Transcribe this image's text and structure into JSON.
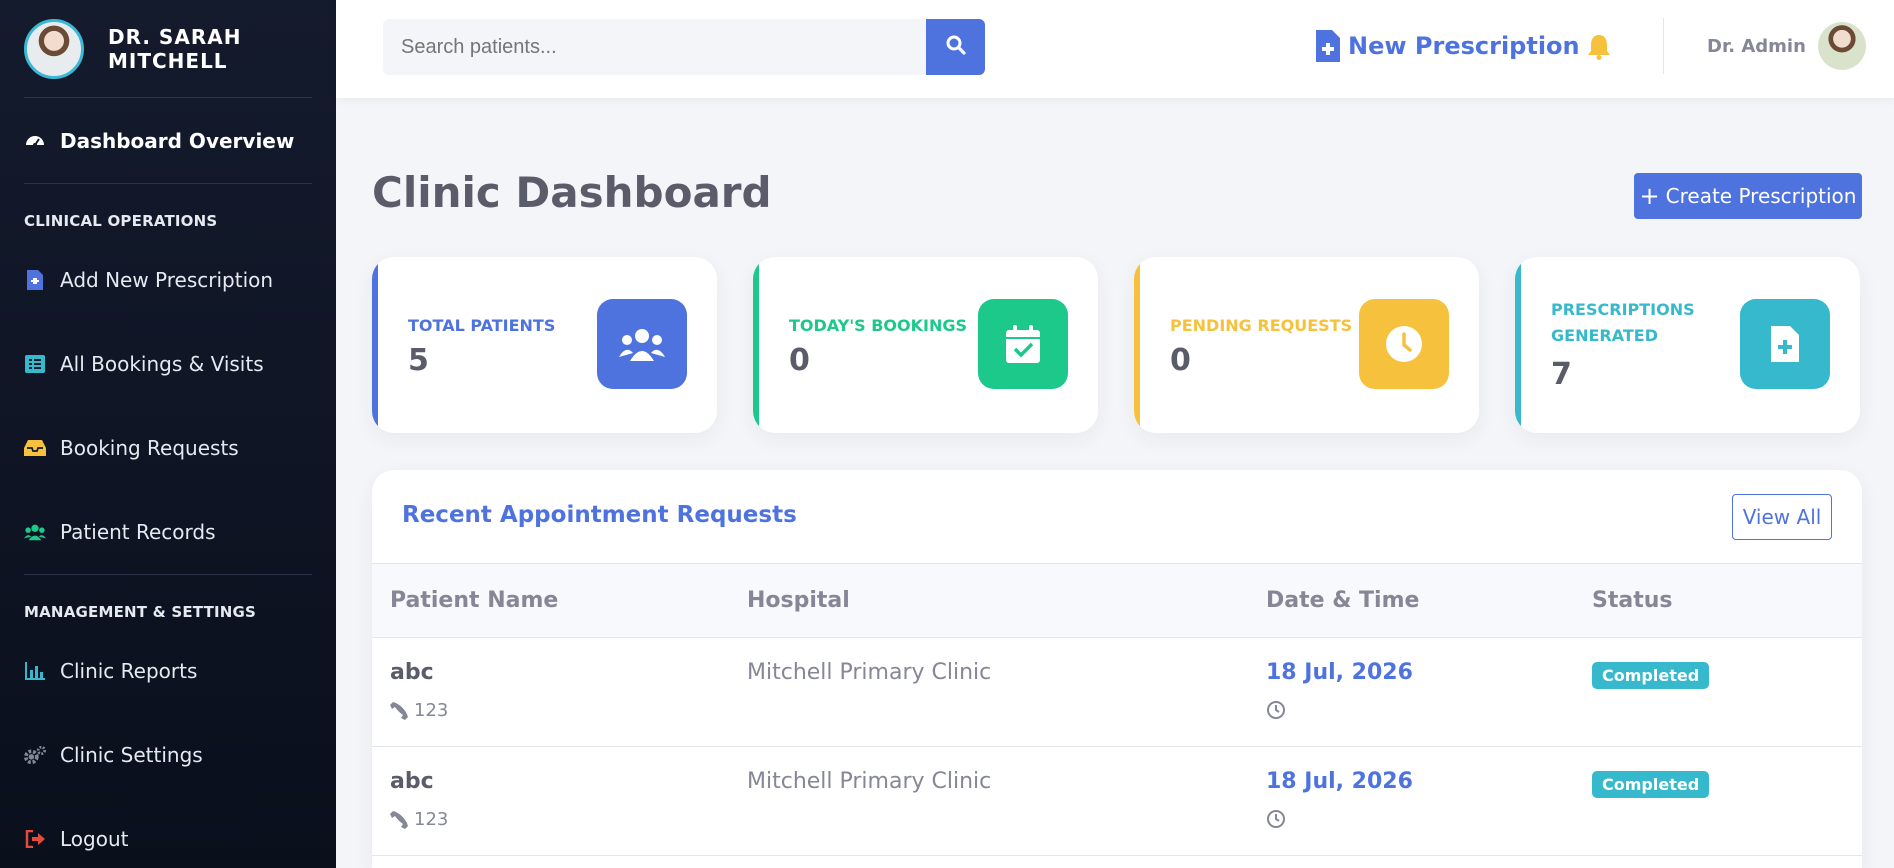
{
  "sidebar": {
    "doctor_name": "DR. SARAH\nMITCHELL",
    "top_item": "Dashboard Overview",
    "section_clinical": "CLINICAL OPERATIONS",
    "clinical_items": [
      "Add New Prescription",
      "All Bookings & Visits",
      "Booking Requests",
      "Patient Records"
    ],
    "section_management": "MANAGEMENT & SETTINGS",
    "management_items": [
      "Clinic Reports",
      "Clinic Settings",
      "Logout"
    ]
  },
  "header": {
    "search_placeholder": "Search patients...",
    "new_prescription": "New Prescription",
    "admin_name": "Dr. Admin"
  },
  "main": {
    "title": "Clinic Dashboard",
    "create_button": "Create Prescription",
    "cards": [
      {
        "label": "TOTAL PATIENTS",
        "value": "5",
        "color": "#4e73df",
        "icon": "users-icon"
      },
      {
        "label": "TODAY'S BOOKINGS",
        "value": "0",
        "color": "#1cc88a",
        "icon": "calendar-check-icon"
      },
      {
        "label": "PENDING REQUESTS",
        "value": "0",
        "color": "#f6c23e",
        "icon": "clock-icon"
      },
      {
        "label": "PRESCRIPTIONS GENERATED",
        "value": "7",
        "color": "#36b9cc",
        "icon": "file-medical-icon"
      }
    ],
    "table": {
      "title": "Recent Appointment Requests",
      "view_all": "View All",
      "columns": [
        "Patient Name",
        "Hospital",
        "Date & Time",
        "Status"
      ],
      "rows": [
        {
          "name": "abc",
          "phone": "123",
          "hospital": "Mitchell Primary Clinic",
          "date": "18 Jul, 2026",
          "status": "Completed"
        },
        {
          "name": "abc",
          "phone": "123",
          "hospital": "Mitchell Primary Clinic",
          "date": "18 Jul, 2026",
          "status": "Completed"
        }
      ]
    }
  },
  "colors": {
    "primary": "#4e73df",
    "success": "#1cc88a",
    "warning": "#f6c23e",
    "info": "#36b9cc",
    "danger": "#e74a3b",
    "sidebar_bg": "#141b2d"
  }
}
